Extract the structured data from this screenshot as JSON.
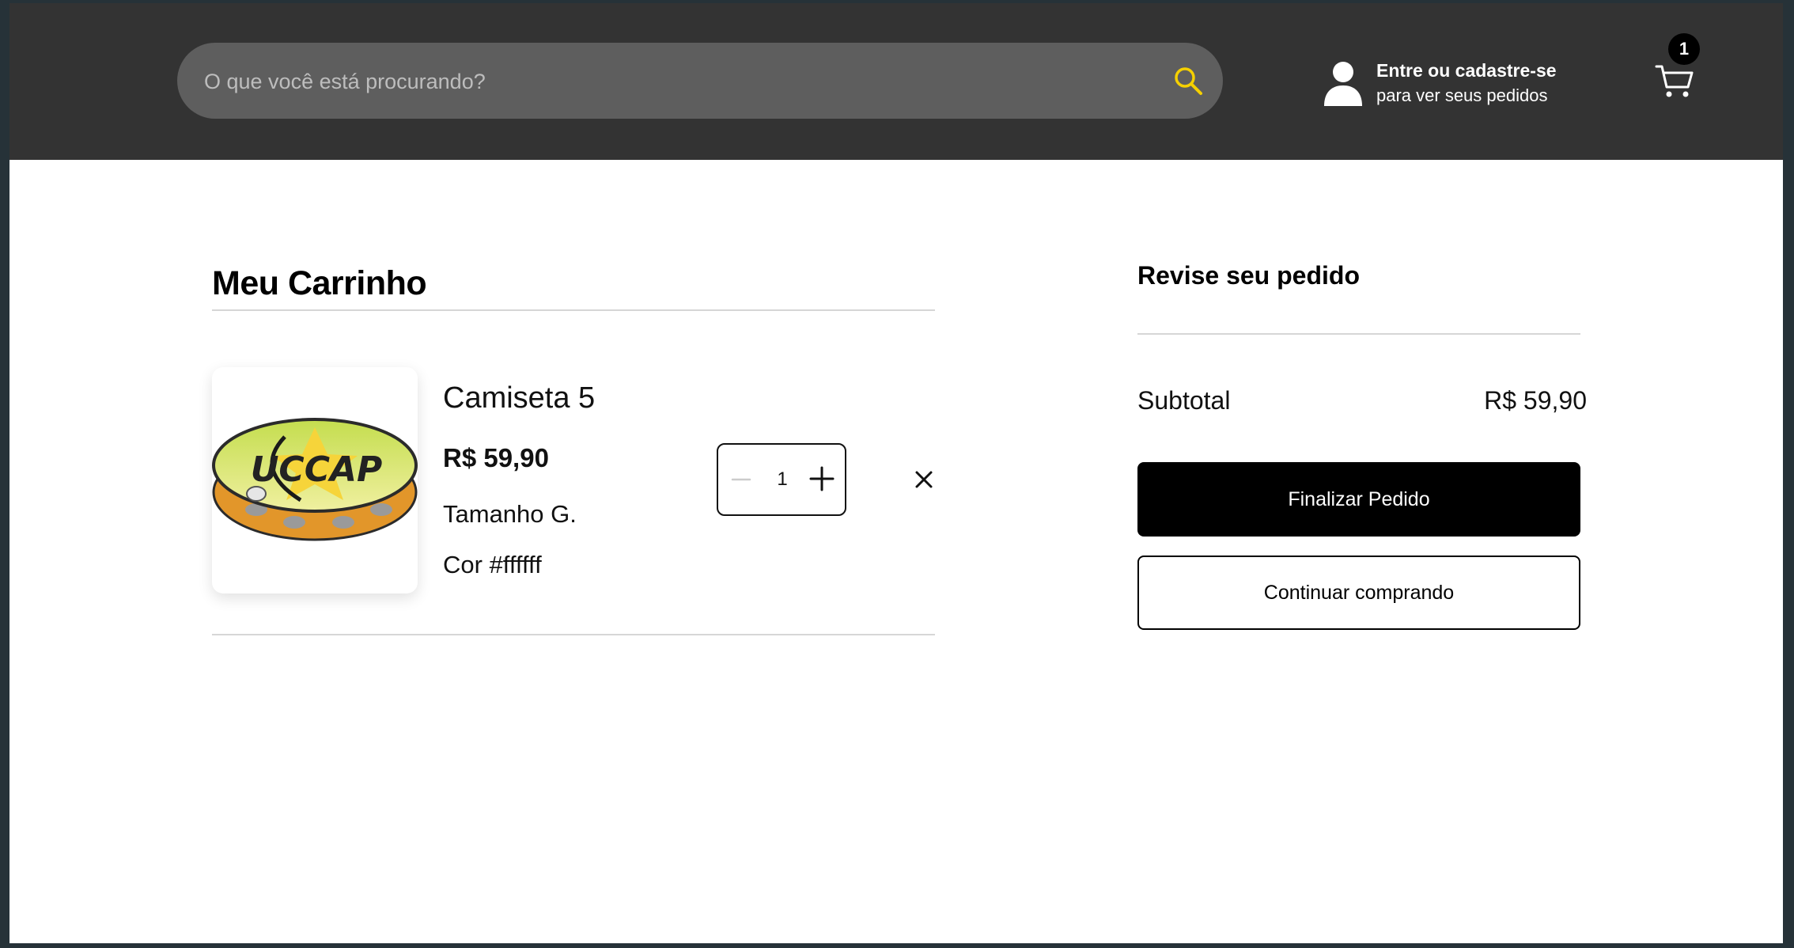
{
  "header": {
    "search": {
      "placeholder": "O que você está procurando?",
      "icon": "search-icon"
    },
    "account": {
      "line1": "Entre ou cadastre-se",
      "line2": "para ver seus pedidos",
      "icon": "user-icon"
    },
    "cart": {
      "icon": "cart-icon",
      "count": "1"
    }
  },
  "cart": {
    "title": "Meu Carrinho",
    "items": [
      {
        "name": "Camiseta 5",
        "price": "R$ 59,90",
        "size": "Tamanho G.",
        "color": "Cor #ffffff",
        "quantity": "1",
        "image_logo_text": "UCCAP"
      }
    ]
  },
  "summary": {
    "title": "Revise seu pedido",
    "subtotal_label": "Subtotal",
    "subtotal_value": "R$ 59,90",
    "checkout_label": "Finalizar Pedido",
    "continue_label": "Continuar comprando"
  },
  "colors": {
    "header_bg": "#333333",
    "search_bg": "#5e5e5e",
    "search_icon": "#f5d000",
    "primary_button": "#000000"
  }
}
